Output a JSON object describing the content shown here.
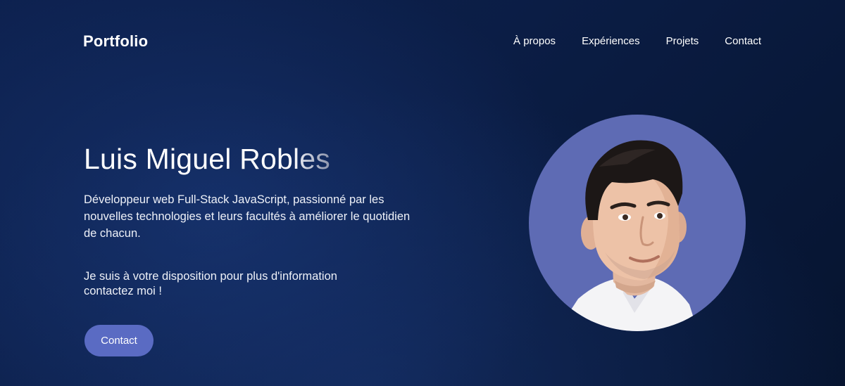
{
  "header": {
    "logo": "Portfolio",
    "nav": [
      {
        "label": "À propos"
      },
      {
        "label": "Expériences"
      },
      {
        "label": "Projets"
      },
      {
        "label": "Contact"
      }
    ]
  },
  "hero": {
    "name_main": "Luis Miguel Rob",
    "name_fade": "les",
    "intro": "Développeur web Full-Stack JavaScript, passionné par les nouvelles technologies et leurs facultés à améliorer le quotidien de chacun.",
    "availability_line1": "Je suis à votre disposition pour plus d'information",
    "availability_line2": "contactez moi !",
    "contact_button": "Contact"
  },
  "colors": {
    "background": "#0b1d45",
    "accent": "#5a6bc3",
    "avatar_background": "#5e6bb4"
  }
}
